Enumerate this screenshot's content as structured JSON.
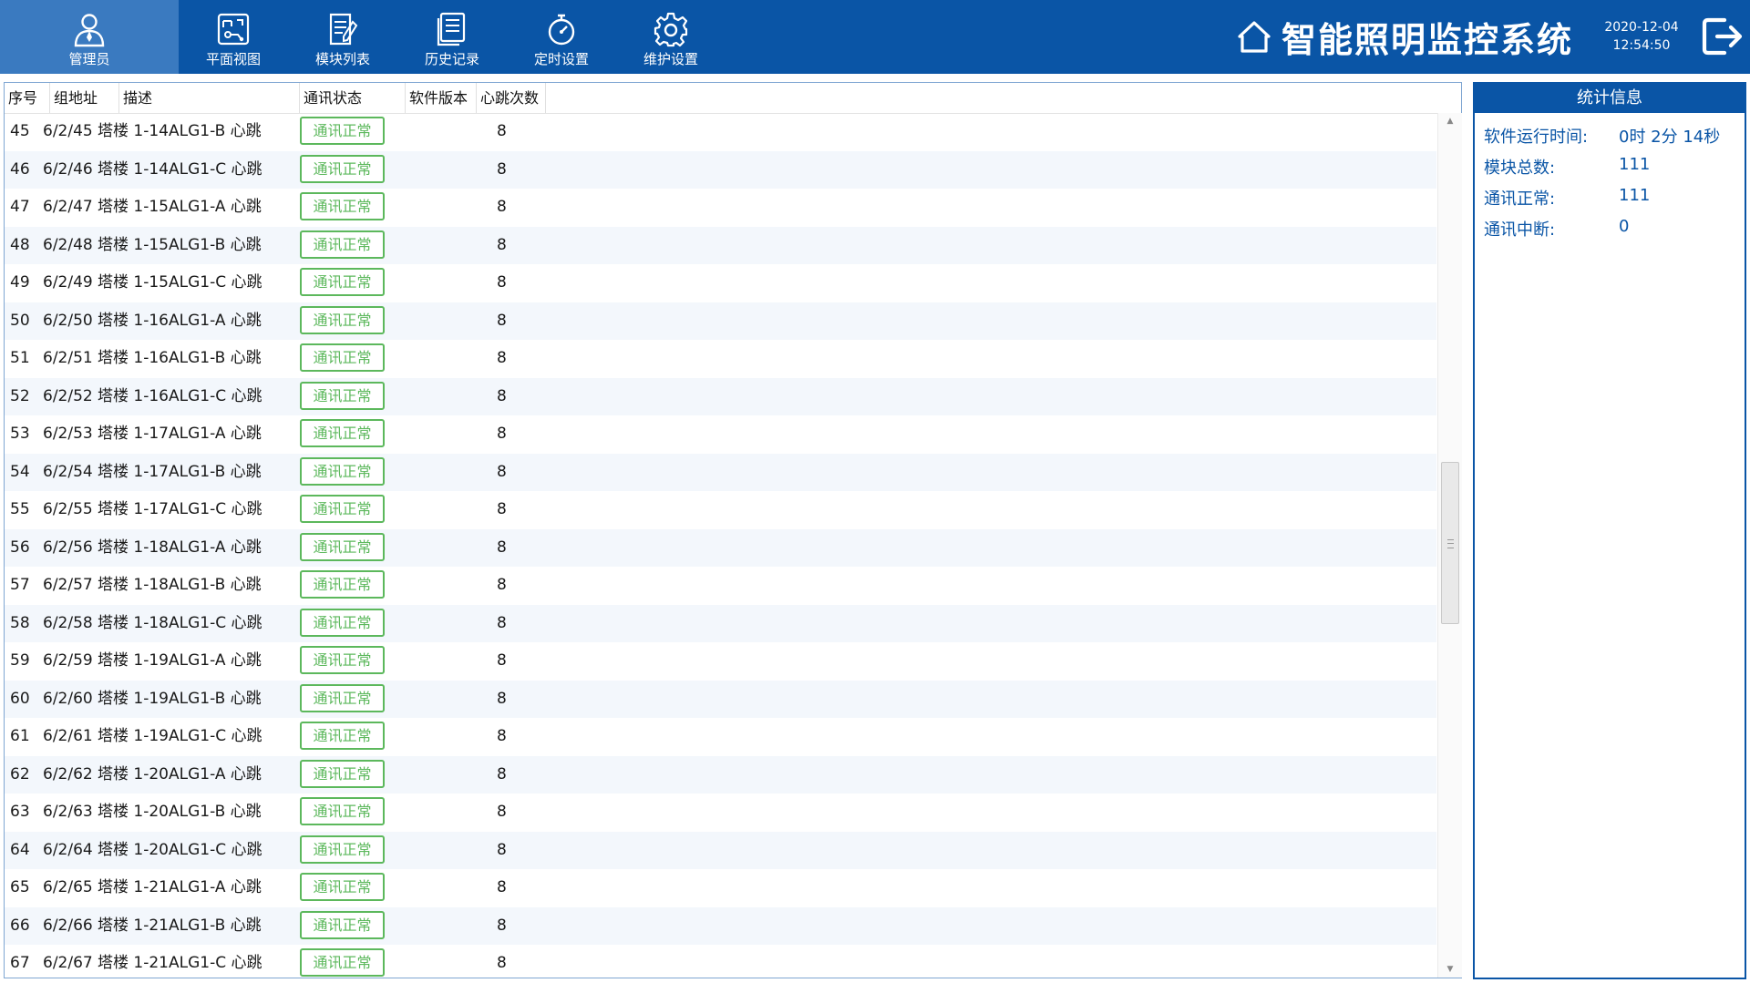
{
  "nav": {
    "items": [
      {
        "label": "管理员",
        "icon": "admin-user-icon"
      },
      {
        "label": "平面视图",
        "icon": "floor-plan-icon"
      },
      {
        "label": "模块列表",
        "icon": "module-list-icon"
      },
      {
        "label": "历史记录",
        "icon": "history-record-icon"
      },
      {
        "label": "定时设置",
        "icon": "timer-icon"
      },
      {
        "label": "维护设置",
        "icon": "gear-icon"
      }
    ]
  },
  "header": {
    "title": "智能照明监控系统",
    "date": "2020-12-04",
    "time": "12:54:50",
    "logout_icon": "logout-icon"
  },
  "table": {
    "columns": [
      "序号",
      "组地址",
      "描述",
      "通讯状态",
      "软件版本",
      "心跳次数"
    ],
    "rows": [
      {
        "no": "45",
        "addr": "6/2/45",
        "desc": "塔楼 1-14ALG1-B 心跳",
        "status": "通讯正常",
        "version": "",
        "beats": "8"
      },
      {
        "no": "46",
        "addr": "6/2/46",
        "desc": "塔楼 1-14ALG1-C 心跳",
        "status": "通讯正常",
        "version": "",
        "beats": "8"
      },
      {
        "no": "47",
        "addr": "6/2/47",
        "desc": "塔楼 1-15ALG1-A 心跳",
        "status": "通讯正常",
        "version": "",
        "beats": "8"
      },
      {
        "no": "48",
        "addr": "6/2/48",
        "desc": "塔楼 1-15ALG1-B 心跳",
        "status": "通讯正常",
        "version": "",
        "beats": "8"
      },
      {
        "no": "49",
        "addr": "6/2/49",
        "desc": "塔楼 1-15ALG1-C 心跳",
        "status": "通讯正常",
        "version": "",
        "beats": "8"
      },
      {
        "no": "50",
        "addr": "6/2/50",
        "desc": "塔楼 1-16ALG1-A 心跳",
        "status": "通讯正常",
        "version": "",
        "beats": "8"
      },
      {
        "no": "51",
        "addr": "6/2/51",
        "desc": "塔楼 1-16ALG1-B 心跳",
        "status": "通讯正常",
        "version": "",
        "beats": "8"
      },
      {
        "no": "52",
        "addr": "6/2/52",
        "desc": "塔楼 1-16ALG1-C 心跳",
        "status": "通讯正常",
        "version": "",
        "beats": "8"
      },
      {
        "no": "53",
        "addr": "6/2/53",
        "desc": "塔楼 1-17ALG1-A 心跳",
        "status": "通讯正常",
        "version": "",
        "beats": "8"
      },
      {
        "no": "54",
        "addr": "6/2/54",
        "desc": "塔楼 1-17ALG1-B 心跳",
        "status": "通讯正常",
        "version": "",
        "beats": "8"
      },
      {
        "no": "55",
        "addr": "6/2/55",
        "desc": "塔楼 1-17ALG1-C 心跳",
        "status": "通讯正常",
        "version": "",
        "beats": "8"
      },
      {
        "no": "56",
        "addr": "6/2/56",
        "desc": "塔楼 1-18ALG1-A 心跳",
        "status": "通讯正常",
        "version": "",
        "beats": "8"
      },
      {
        "no": "57",
        "addr": "6/2/57",
        "desc": "塔楼 1-18ALG1-B 心跳",
        "status": "通讯正常",
        "version": "",
        "beats": "8"
      },
      {
        "no": "58",
        "addr": "6/2/58",
        "desc": "塔楼 1-18ALG1-C 心跳",
        "status": "通讯正常",
        "version": "",
        "beats": "8"
      },
      {
        "no": "59",
        "addr": "6/2/59",
        "desc": "塔楼 1-19ALG1-A 心跳",
        "status": "通讯正常",
        "version": "",
        "beats": "8"
      },
      {
        "no": "60",
        "addr": "6/2/60",
        "desc": "塔楼 1-19ALG1-B 心跳",
        "status": "通讯正常",
        "version": "",
        "beats": "8"
      },
      {
        "no": "61",
        "addr": "6/2/61",
        "desc": "塔楼 1-19ALG1-C 心跳",
        "status": "通讯正常",
        "version": "",
        "beats": "8"
      },
      {
        "no": "62",
        "addr": "6/2/62",
        "desc": "塔楼 1-20ALG1-A 心跳",
        "status": "通讯正常",
        "version": "",
        "beats": "8"
      },
      {
        "no": "63",
        "addr": "6/2/63",
        "desc": "塔楼 1-20ALG1-B 心跳",
        "status": "通讯正常",
        "version": "",
        "beats": "8"
      },
      {
        "no": "64",
        "addr": "6/2/64",
        "desc": "塔楼 1-20ALG1-C 心跳",
        "status": "通讯正常",
        "version": "",
        "beats": "8"
      },
      {
        "no": "65",
        "addr": "6/2/65",
        "desc": "塔楼 1-21ALG1-A 心跳",
        "status": "通讯正常",
        "version": "",
        "beats": "8"
      },
      {
        "no": "66",
        "addr": "6/2/66",
        "desc": "塔楼 1-21ALG1-B 心跳",
        "status": "通讯正常",
        "version": "",
        "beats": "8"
      },
      {
        "no": "67",
        "addr": "6/2/67",
        "desc": "塔楼 1-21ALG1-C 心跳",
        "status": "通讯正常",
        "version": "",
        "beats": "8"
      }
    ]
  },
  "stats": {
    "title": "统计信息",
    "items": [
      {
        "label": "软件运行时间:",
        "value": "0时 2分 14秒"
      },
      {
        "label": "模块总数:",
        "value": "111"
      },
      {
        "label": "通讯正常:",
        "value": "111"
      },
      {
        "label": "通讯中断:",
        "value": "0"
      }
    ]
  },
  "colors": {
    "brand_blue": "#0a55a6",
    "nav_active": "#3a7ac0",
    "status_ok_green": "#5cb85c"
  }
}
